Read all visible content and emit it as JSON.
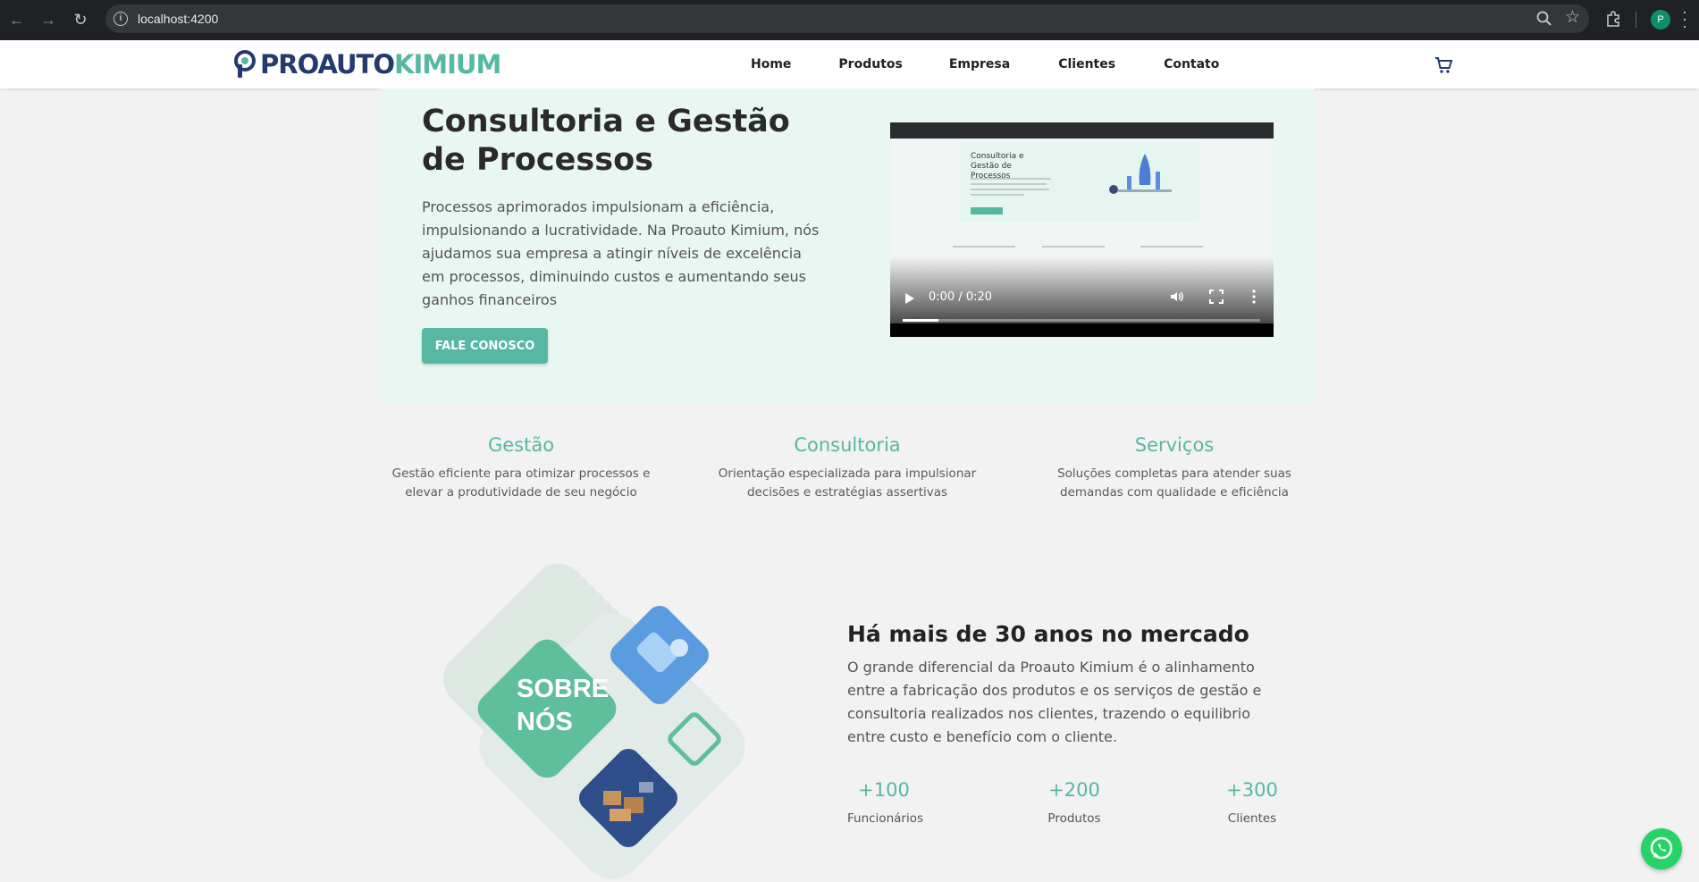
{
  "browser": {
    "url": "localhost:4200",
    "profile_initial": "P"
  },
  "header": {
    "logo_part1": "PROAUTO",
    "logo_part2": "KIMIUM",
    "nav": [
      "Home",
      "Produtos",
      "Empresa",
      "Clientes",
      "Contato"
    ]
  },
  "hero": {
    "title": "Consultoria e Gestão de Processos",
    "text": "Processos aprimorados impulsionam a eficiência, impulsionando a lucratividade. Na Proauto Kimium, nós ajudamos sua empresa a atingir níveis de excelência em processos, diminuindo custos e aumentando seus ganhos financeiros",
    "cta": "FALE CONOSCO",
    "video_time": "0:00 / 0:20",
    "video_progress": 0.1
  },
  "features": [
    {
      "title": "Gestão",
      "text": "Gestão eficiente para otimizar processos e elevar a produtividade de seu negócio"
    },
    {
      "title": "Consultoria",
      "text": "Orientação especializada para impulsionar decisões e estratégias assertivas"
    },
    {
      "title": "Serviços",
      "text": "Soluções completas para atender suas demandas com qualidade e eficiência"
    }
  ],
  "about": {
    "badge_line1": "SOBRE",
    "badge_line2": "NÓS",
    "title": "Há mais de 30 anos no mercado",
    "text": "O grande diferencial da Proauto Kimium é o alinhamento entre a fabricação dos produtos e os serviços de gestão e consultoria realizados nos clientes, trazendo o equilibrio entre custo e benefício com o cliente.",
    "stats": [
      {
        "value": "+100",
        "label": "Funcionários"
      },
      {
        "value": "+200",
        "label": "Produtos"
      },
      {
        "value": "+300",
        "label": "Clientes"
      }
    ]
  },
  "colors": {
    "accent": "#56b8a2",
    "brand_dark": "#233a6e",
    "hero_bg": "#e8f7f1"
  }
}
